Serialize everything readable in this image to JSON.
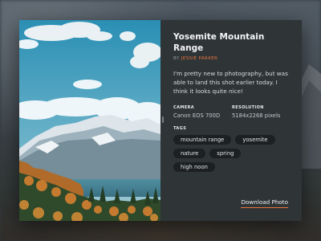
{
  "photo": {
    "title": "Yosemite Mountain Range",
    "byline_prefix": "BY",
    "author": "JESSIE PARKER",
    "description": "I'm pretty new to photography, but was able to land this shot earlier today. I think it looks quite nice!",
    "camera_label": "CAMERA",
    "camera": "Canon EOS 700D",
    "resolution_label": "RESOLUTION",
    "resolution": "5184x2268 pixels",
    "tags_label": "TAGS",
    "tags": [
      "mountain range",
      "yosemite",
      "nature",
      "spring",
      "high noon"
    ],
    "download_label": "Download Photo"
  },
  "colors": {
    "accent": "#e8743b",
    "card_bg": "#2f3437",
    "tag_bg": "#1c2023"
  },
  "icons": {
    "divider": "drag-handle-icon"
  }
}
